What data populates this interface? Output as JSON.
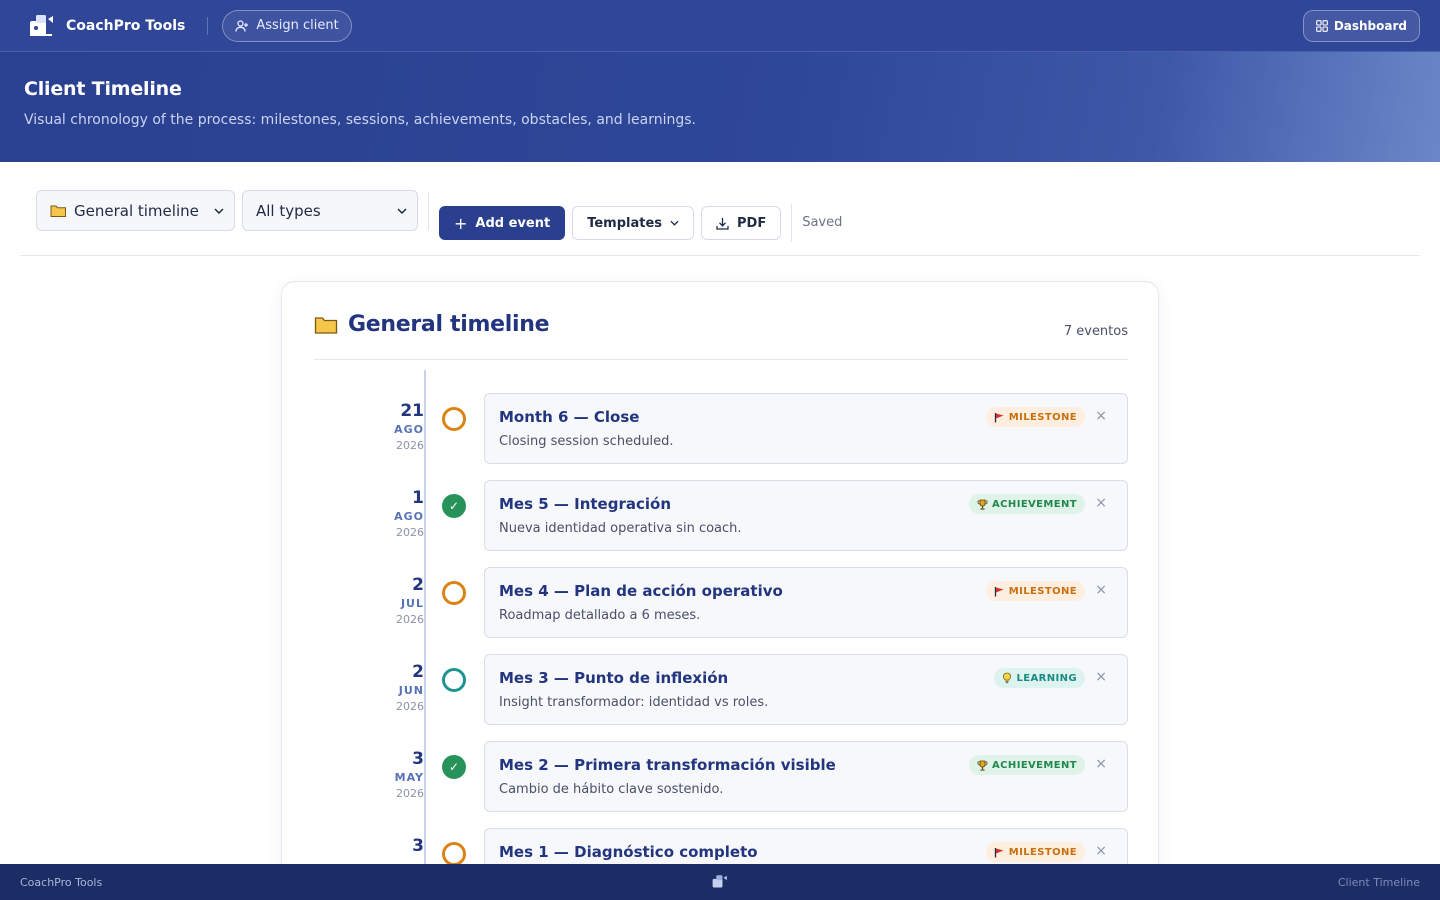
{
  "topbar": {
    "brand": "CoachPro Tools",
    "assign_label": "Assign client",
    "dashboard_label": "Dashboard"
  },
  "hero": {
    "title": "Client Timeline",
    "subtitle": "Visual chronology of the process: milestones, sessions, achievements, obstacles, and learnings."
  },
  "toolbar": {
    "timeline_select": "General timeline",
    "type_select": "All types",
    "add_label": "Add event",
    "templates_label": "Templates",
    "pdf_label": "PDF",
    "status": "Saved"
  },
  "card": {
    "title": "General timeline",
    "count": "7 eventos"
  },
  "events": [
    {
      "day": "21",
      "month": "AGO",
      "year": "2026",
      "title": "Month 6 — Close",
      "desc": "Closing session scheduled.",
      "badge": "MILESTONE",
      "marker": "pending-orange"
    },
    {
      "day": "1",
      "month": "AGO",
      "year": "2026",
      "title": "Mes 5 — Integración",
      "desc": "Nueva identidad operativa sin coach.",
      "badge": "ACHIEVEMENT",
      "marker": "done-green"
    },
    {
      "day": "2",
      "month": "JUL",
      "year": "2026",
      "title": "Mes 4 — Plan de acción operativo",
      "desc": "Roadmap detallado a 6 meses.",
      "badge": "MILESTONE",
      "marker": "pending-orange"
    },
    {
      "day": "2",
      "month": "JUN",
      "year": "2026",
      "title": "Mes 3 — Punto de inflexión",
      "desc": "Insight transformador: identidad vs roles.",
      "badge": "LEARNING",
      "marker": "pending-teal"
    },
    {
      "day": "3",
      "month": "MAY",
      "year": "2026",
      "title": "Mes 2 — Primera transformación visible",
      "desc": "Cambio de hábito clave sostenido.",
      "badge": "ACHIEVEMENT",
      "marker": "done-green"
    },
    {
      "day": "3",
      "month": "",
      "year": "",
      "title": "Mes 1 — Diagnóstico completo",
      "desc": "",
      "badge": "MILESTONE",
      "marker": "pending-orange"
    }
  ],
  "footer": {
    "left": "CoachPro Tools",
    "right": "Client Timeline"
  },
  "colors": {
    "primary": "#2b3f8f",
    "milestone": "#d98414",
    "achievement": "#27935a",
    "learning": "#1d9490"
  }
}
